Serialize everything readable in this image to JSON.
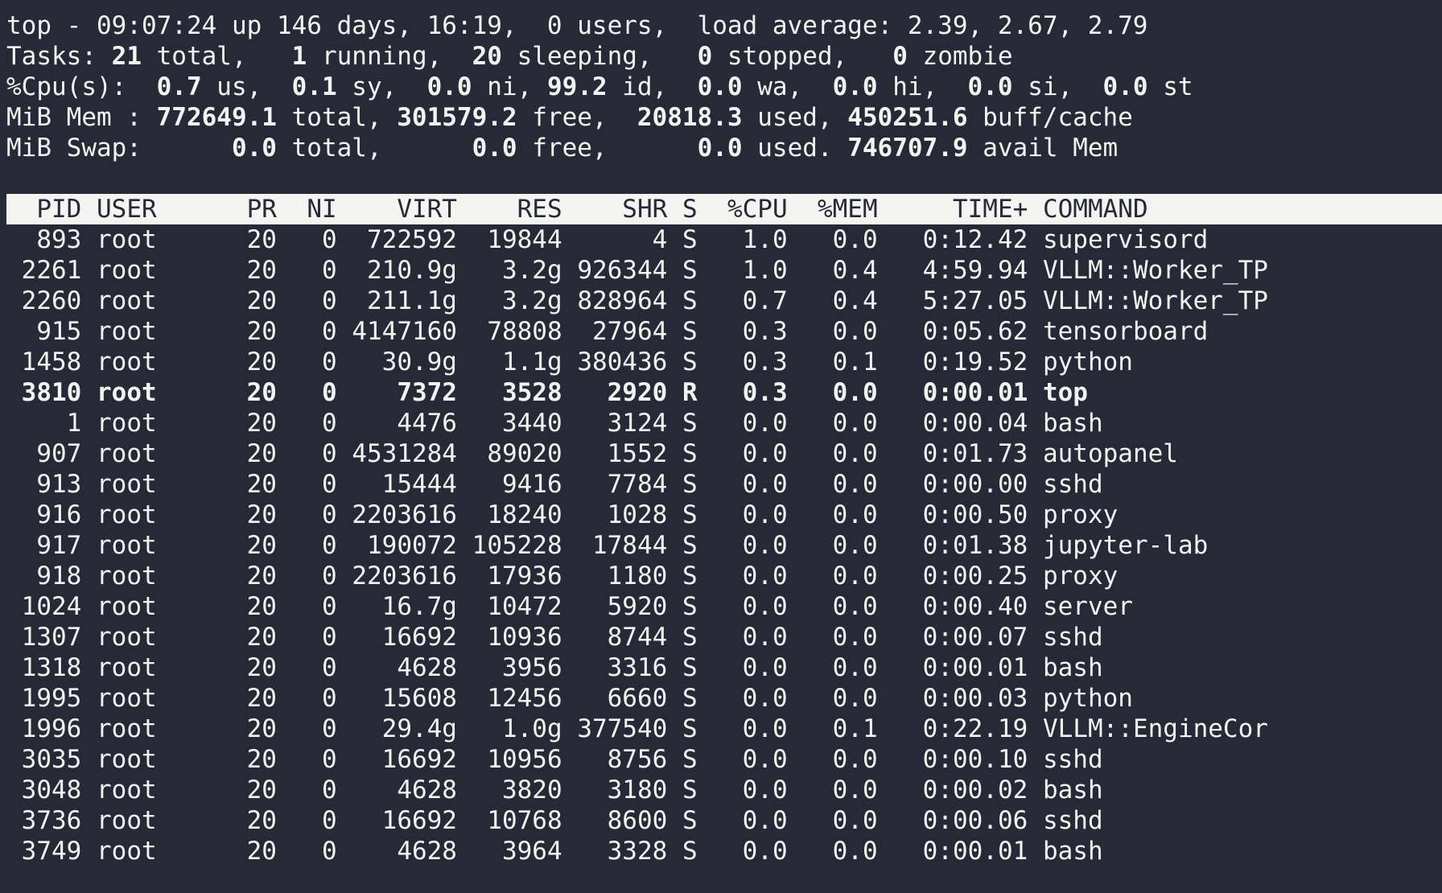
{
  "summary": {
    "top": {
      "prefix": "top - ",
      "time": "09:07:24",
      "uptime_text": " up 146 days, 16:19,  ",
      "users": "0",
      "users_label": " users,  load average: ",
      "load_average": "2.39, 2.67, 2.79"
    },
    "tasks": {
      "label": "Tasks: ",
      "total": "21",
      "total_label": " total,   ",
      "running": "1",
      "running_label": " running,  ",
      "sleeping": "20",
      "sleeping_label": " sleeping,   ",
      "stopped": "0",
      "stopped_label": " stopped,   ",
      "zombie": "0",
      "zombie_label": " zombie"
    },
    "cpu": {
      "label": "%Cpu(s):  ",
      "us": "0.7",
      "us_label": " us,  ",
      "sy": "0.1",
      "sy_label": " sy,  ",
      "ni": "0.0",
      "ni_label": " ni, ",
      "id": "99.2",
      "id_label": " id,  ",
      "wa": "0.0",
      "wa_label": " wa,  ",
      "hi": "0.0",
      "hi_label": " hi,  ",
      "si": "0.0",
      "si_label": " si,  ",
      "st": "0.0",
      "st_label": " st"
    },
    "mem": {
      "label": "MiB Mem : ",
      "total": "772649.1",
      "total_label": " total, ",
      "free": "301579.2",
      "free_label": " free,  ",
      "used": "20818.3",
      "used_label": " used, ",
      "buff_cache": "450251.6",
      "buff_cache_label": " buff/cache"
    },
    "swap": {
      "label": "MiB Swap:      ",
      "total": "0.0",
      "total_label": " total,      ",
      "free": "0.0",
      "free_label": " free,      ",
      "used": "0.0",
      "used_label": " used. ",
      "avail": "746707.9",
      "avail_label": " avail Mem"
    }
  },
  "table": {
    "columns": [
      "PID",
      "USER",
      "PR",
      "NI",
      "VIRT",
      "RES",
      "SHR",
      "S",
      "%CPU",
      "%MEM",
      "TIME+",
      "COMMAND"
    ],
    "rows": [
      {
        "pid": "893",
        "user": "root",
        "pr": "20",
        "ni": "0",
        "virt": "722592",
        "res": "19844",
        "shr": "4",
        "s": "S",
        "cpu": "1.0",
        "mem": "0.0",
        "time": "0:12.42",
        "command": "supervisord"
      },
      {
        "pid": "2261",
        "user": "root",
        "pr": "20",
        "ni": "0",
        "virt": "210.9g",
        "res": "3.2g",
        "shr": "926344",
        "s": "S",
        "cpu": "1.0",
        "mem": "0.4",
        "time": "4:59.94",
        "command": "VLLM::Worker_TP"
      },
      {
        "pid": "2260",
        "user": "root",
        "pr": "20",
        "ni": "0",
        "virt": "211.1g",
        "res": "3.2g",
        "shr": "828964",
        "s": "S",
        "cpu": "0.7",
        "mem": "0.4",
        "time": "5:27.05",
        "command": "VLLM::Worker_TP"
      },
      {
        "pid": "915",
        "user": "root",
        "pr": "20",
        "ni": "0",
        "virt": "4147160",
        "res": "78808",
        "shr": "27964",
        "s": "S",
        "cpu": "0.3",
        "mem": "0.0",
        "time": "0:05.62",
        "command": "tensorboard"
      },
      {
        "pid": "1458",
        "user": "root",
        "pr": "20",
        "ni": "0",
        "virt": "30.9g",
        "res": "1.1g",
        "shr": "380436",
        "s": "S",
        "cpu": "0.3",
        "mem": "0.1",
        "time": "0:19.52",
        "command": "python"
      },
      {
        "pid": "3810",
        "user": "root",
        "pr": "20",
        "ni": "0",
        "virt": "7372",
        "res": "3528",
        "shr": "2920",
        "s": "R",
        "cpu": "0.3",
        "mem": "0.0",
        "time": "0:00.01",
        "command": "top",
        "bold": true
      },
      {
        "pid": "1",
        "user": "root",
        "pr": "20",
        "ni": "0",
        "virt": "4476",
        "res": "3440",
        "shr": "3124",
        "s": "S",
        "cpu": "0.0",
        "mem": "0.0",
        "time": "0:00.04",
        "command": "bash"
      },
      {
        "pid": "907",
        "user": "root",
        "pr": "20",
        "ni": "0",
        "virt": "4531284",
        "res": "89020",
        "shr": "1552",
        "s": "S",
        "cpu": "0.0",
        "mem": "0.0",
        "time": "0:01.73",
        "command": "autopanel"
      },
      {
        "pid": "913",
        "user": "root",
        "pr": "20",
        "ni": "0",
        "virt": "15444",
        "res": "9416",
        "shr": "7784",
        "s": "S",
        "cpu": "0.0",
        "mem": "0.0",
        "time": "0:00.00",
        "command": "sshd"
      },
      {
        "pid": "916",
        "user": "root",
        "pr": "20",
        "ni": "0",
        "virt": "2203616",
        "res": "18240",
        "shr": "1028",
        "s": "S",
        "cpu": "0.0",
        "mem": "0.0",
        "time": "0:00.50",
        "command": "proxy"
      },
      {
        "pid": "917",
        "user": "root",
        "pr": "20",
        "ni": "0",
        "virt": "190072",
        "res": "105228",
        "shr": "17844",
        "s": "S",
        "cpu": "0.0",
        "mem": "0.0",
        "time": "0:01.38",
        "command": "jupyter-lab"
      },
      {
        "pid": "918",
        "user": "root",
        "pr": "20",
        "ni": "0",
        "virt": "2203616",
        "res": "17936",
        "shr": "1180",
        "s": "S",
        "cpu": "0.0",
        "mem": "0.0",
        "time": "0:00.25",
        "command": "proxy"
      },
      {
        "pid": "1024",
        "user": "root",
        "pr": "20",
        "ni": "0",
        "virt": "16.7g",
        "res": "10472",
        "shr": "5920",
        "s": "S",
        "cpu": "0.0",
        "mem": "0.0",
        "time": "0:00.40",
        "command": "server"
      },
      {
        "pid": "1307",
        "user": "root",
        "pr": "20",
        "ni": "0",
        "virt": "16692",
        "res": "10936",
        "shr": "8744",
        "s": "S",
        "cpu": "0.0",
        "mem": "0.0",
        "time": "0:00.07",
        "command": "sshd"
      },
      {
        "pid": "1318",
        "user": "root",
        "pr": "20",
        "ni": "0",
        "virt": "4628",
        "res": "3956",
        "shr": "3316",
        "s": "S",
        "cpu": "0.0",
        "mem": "0.0",
        "time": "0:00.01",
        "command": "bash"
      },
      {
        "pid": "1995",
        "user": "root",
        "pr": "20",
        "ni": "0",
        "virt": "15608",
        "res": "12456",
        "shr": "6660",
        "s": "S",
        "cpu": "0.0",
        "mem": "0.0",
        "time": "0:00.03",
        "command": "python"
      },
      {
        "pid": "1996",
        "user": "root",
        "pr": "20",
        "ni": "0",
        "virt": "29.4g",
        "res": "1.0g",
        "shr": "377540",
        "s": "S",
        "cpu": "0.0",
        "mem": "0.1",
        "time": "0:22.19",
        "command": "VLLM::EngineCor"
      },
      {
        "pid": "3035",
        "user": "root",
        "pr": "20",
        "ni": "0",
        "virt": "16692",
        "res": "10956",
        "shr": "8756",
        "s": "S",
        "cpu": "0.0",
        "mem": "0.0",
        "time": "0:00.10",
        "command": "sshd"
      },
      {
        "pid": "3048",
        "user": "root",
        "pr": "20",
        "ni": "0",
        "virt": "4628",
        "res": "3820",
        "shr": "3180",
        "s": "S",
        "cpu": "0.0",
        "mem": "0.0",
        "time": "0:00.02",
        "command": "bash"
      },
      {
        "pid": "3736",
        "user": "root",
        "pr": "20",
        "ni": "0",
        "virt": "16692",
        "res": "10768",
        "shr": "8600",
        "s": "S",
        "cpu": "0.0",
        "mem": "0.0",
        "time": "0:00.06",
        "command": "sshd"
      },
      {
        "pid": "3749",
        "user": "root",
        "pr": "20",
        "ni": "0",
        "virt": "4628",
        "res": "3964",
        "shr": "3328",
        "s": "S",
        "cpu": "0.0",
        "mem": "0.0",
        "time": "0:00.01",
        "command": "bash"
      }
    ]
  }
}
